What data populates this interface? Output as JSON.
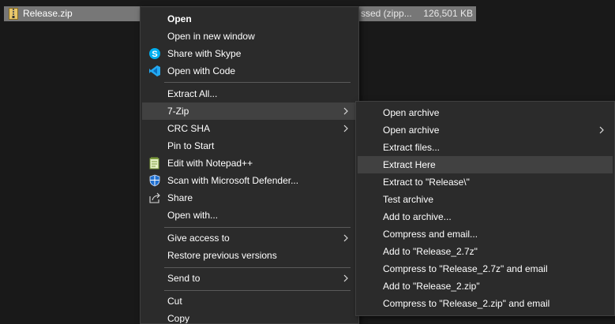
{
  "file": {
    "name": "Release.zip",
    "type": "ssed (zipp...",
    "size": "126,501 KB"
  },
  "main_menu": {
    "open": "Open",
    "open_new_window": "Open in new window",
    "share_skype": "Share with Skype",
    "open_code": "Open with Code",
    "extract_all": "Extract All...",
    "seven_zip": "7-Zip",
    "crc_sha": "CRC SHA",
    "pin_start": "Pin to Start",
    "edit_notepad": "Edit with Notepad++",
    "scan_defender": "Scan with Microsoft Defender...",
    "share": "Share",
    "open_with": "Open with...",
    "give_access": "Give access to",
    "restore_versions": "Restore previous versions",
    "send_to": "Send to",
    "cut": "Cut",
    "copy": "Copy"
  },
  "sub_menu": {
    "open_archive": "Open archive",
    "open_archive_more": "Open archive",
    "extract_files": "Extract files...",
    "extract_here": "Extract Here",
    "extract_to": "Extract to \"Release\\\"",
    "test_archive": "Test archive",
    "add_archive": "Add to archive...",
    "compress_email": "Compress and email...",
    "add_7z": "Add to \"Release_2.7z\"",
    "compress_7z_email": "Compress to \"Release_2.7z\" and email",
    "add_zip": "Add to \"Release_2.zip\"",
    "compress_zip_email": "Compress to \"Release_2.zip\" and email"
  },
  "icons": {
    "zip": "zip-file-icon",
    "skype": "skype-icon",
    "vscode": "vscode-icon",
    "notepadpp": "notepadpp-icon",
    "defender": "defender-shield-icon",
    "share": "share-icon",
    "chevron": "chevron-right-icon"
  },
  "colors": {
    "background": "#191919",
    "menu_bg": "#2b2b2b",
    "highlight": "#414141",
    "selected_row": "#777777",
    "skype_blue": "#00aff0",
    "vscode_blue": "#23a9f2"
  }
}
